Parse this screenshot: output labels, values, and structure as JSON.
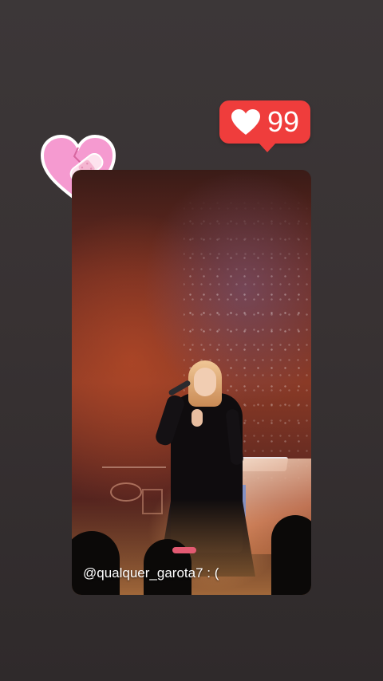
{
  "story": {
    "caption": "@qualquer_garota7 : (",
    "like_sticker": {
      "count": "99",
      "icon": "heart-icon",
      "color": "#ef3d3c"
    },
    "sticker": {
      "icon": "broken-heart-bandage-icon",
      "color": "#f59ad0"
    },
    "background_color": "#3a3536"
  }
}
